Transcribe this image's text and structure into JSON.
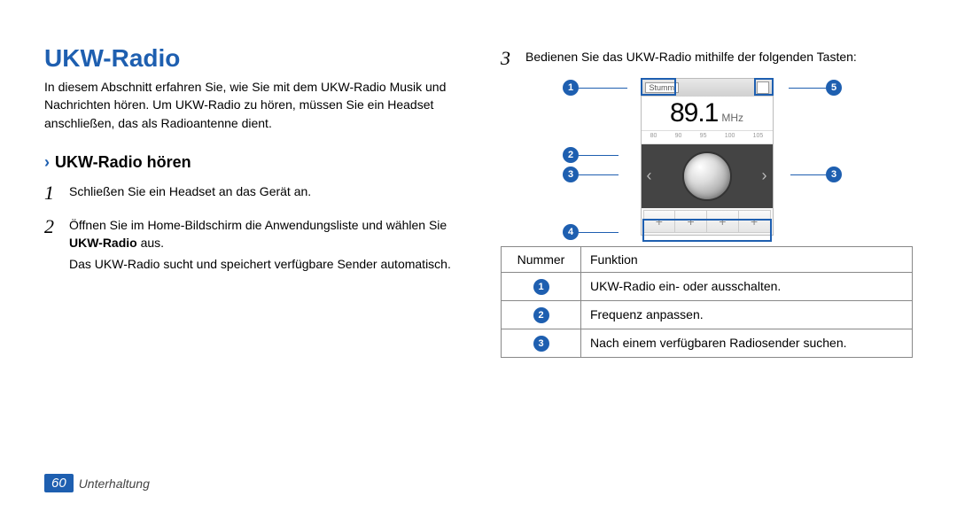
{
  "left": {
    "title": "UKW-Radio",
    "intro": "In diesem Abschnitt erfahren Sie, wie Sie mit dem UKW-Radio Musik und Nachrichten hören. Um UKW-Radio zu hören, müssen Sie ein Headset anschließen, das als Radioantenne dient.",
    "sub_heading": "UKW-Radio hören",
    "steps": {
      "s1_num": "1",
      "s1_text": "Schließen Sie ein Headset an das Gerät an.",
      "s2_num": "2",
      "s2_text_a": "Öffnen Sie im Home-Bildschirm die Anwendungsliste und wählen Sie ",
      "s2_text_bold": "UKW-Radio",
      "s2_text_b": " aus.",
      "s2_sub": "Das UKW-Radio sucht und speichert verfügbare Sender automatisch."
    }
  },
  "right": {
    "step3_num": "3",
    "step3_text": "Bedienen Sie das UKW-Radio mithilfe der folgenden Tasten:",
    "radio": {
      "stumm_label": "Stumm",
      "freq": "89.1",
      "unit": "MHz",
      "scale": [
        "80",
        "90",
        "95",
        "100",
        "105"
      ],
      "preset_label": "+"
    },
    "callouts": {
      "c1": "1",
      "c2": "2",
      "c3": "3",
      "c4": "4",
      "c5": "5"
    },
    "table": {
      "header_num": "Nummer",
      "header_func": "Funktion",
      "rows": [
        {
          "id": "1",
          "text": "UKW-Radio ein- oder ausschalten."
        },
        {
          "id": "2",
          "text": "Frequenz anpassen."
        },
        {
          "id": "3",
          "text": "Nach einem verfügbaren Radiosender suchen."
        }
      ]
    }
  },
  "footer": {
    "page": "60",
    "section": "Unterhaltung"
  }
}
